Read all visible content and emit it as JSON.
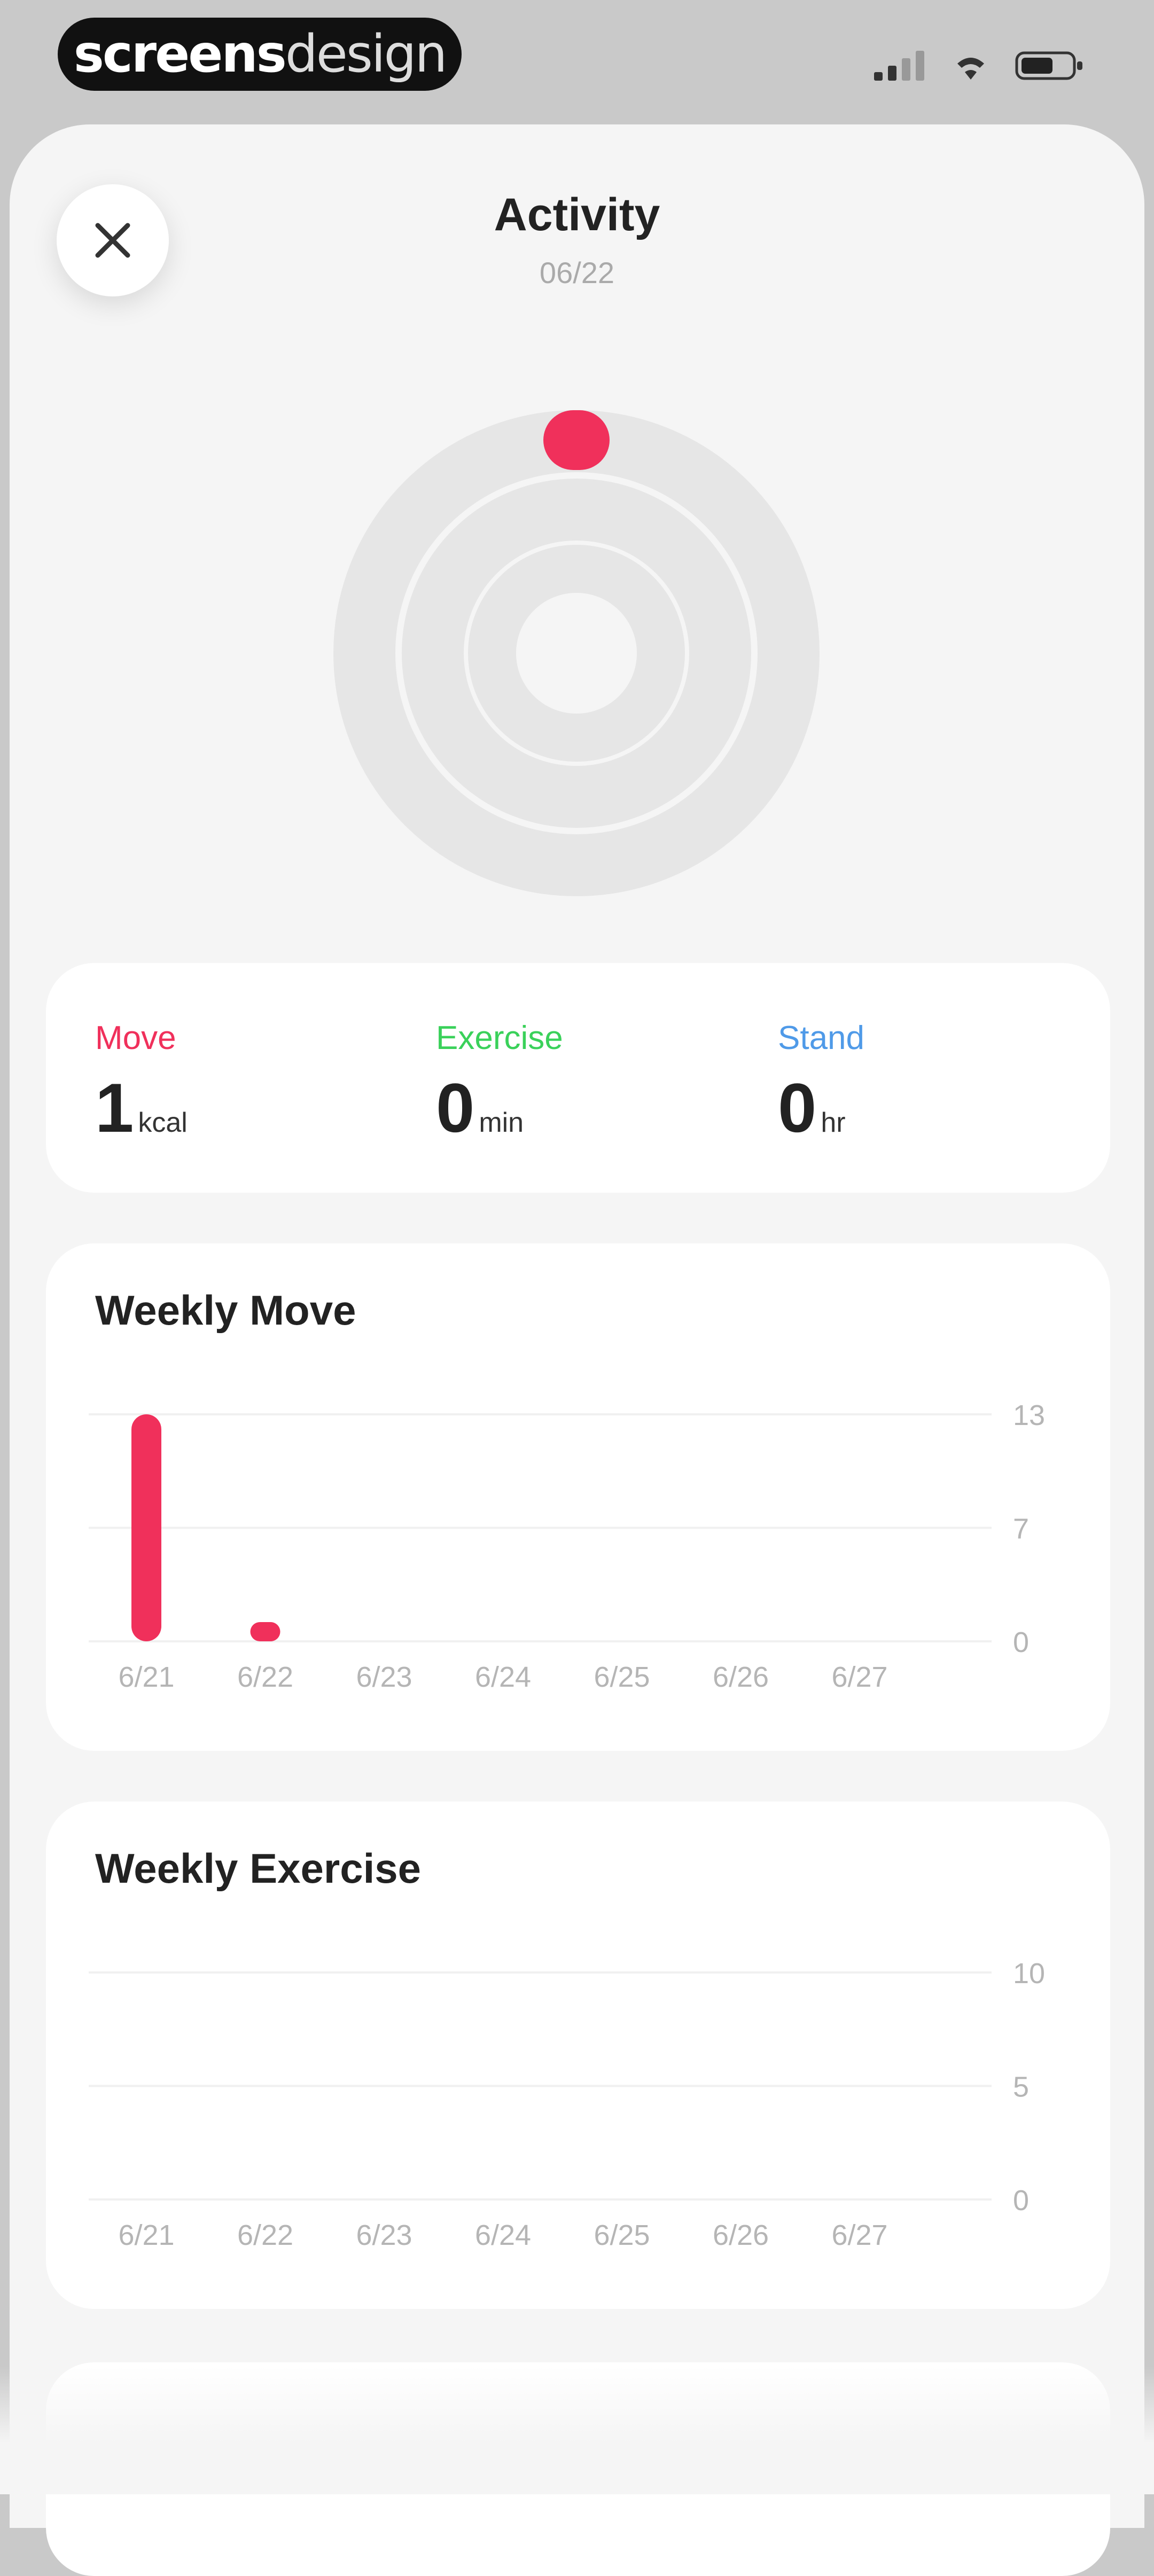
{
  "status_bar": {
    "logo_bold": "screens",
    "logo_light": "design"
  },
  "header": {
    "title": "Activity",
    "date": "06/22",
    "close_icon": "close-icon"
  },
  "rings": {
    "move_color": "#f0305b",
    "track_color": "#e6e6e6"
  },
  "summary": {
    "move": {
      "label": "Move",
      "value": "1",
      "unit": "kcal",
      "color": "#f0305b"
    },
    "exercise": {
      "label": "Exercise",
      "value": "0",
      "unit": "min",
      "color": "#3ad15a"
    },
    "stand": {
      "label": "Stand",
      "value": "0",
      "unit": "hr",
      "color": "#4f9ae8"
    }
  },
  "chart_data": [
    {
      "type": "bar",
      "title": "Weekly Move",
      "categories": [
        "6/21",
        "6/22",
        "6/23",
        "6/24",
        "6/25",
        "6/26",
        "6/27"
      ],
      "values": [
        13,
        0.5,
        0,
        0,
        0,
        0,
        0
      ],
      "yticks": [
        "13",
        "7",
        "0"
      ],
      "ylim": [
        0,
        13
      ],
      "color": "#f0305b"
    },
    {
      "type": "bar",
      "title": "Weekly Exercise",
      "categories": [
        "6/21",
        "6/22",
        "6/23",
        "6/24",
        "6/25",
        "6/26",
        "6/27"
      ],
      "values": [
        0,
        0,
        0,
        0,
        0,
        0,
        0
      ],
      "yticks": [
        "10",
        "5",
        "0"
      ],
      "ylim": [
        0,
        10
      ],
      "color": "#3ad15a"
    }
  ]
}
